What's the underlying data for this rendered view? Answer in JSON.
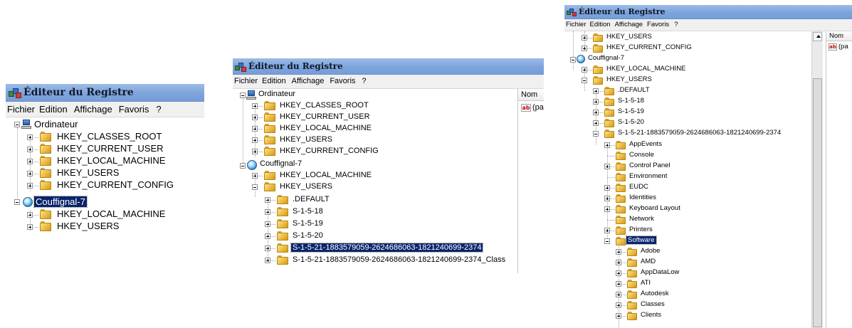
{
  "title": "Éditeur du Registre",
  "menu": [
    "Fichier",
    "Edition",
    "Affichage",
    "Favoris",
    "?"
  ],
  "column_name": "Nom",
  "value_truncated": "(pa",
  "tree": {
    "computer": "Ordinateur",
    "hkcr": "HKEY_CLASSES_ROOT",
    "hkcu": "HKEY_CURRENT_USER",
    "hklm": "HKEY_LOCAL_MACHINE",
    "hku": "HKEY_USERS",
    "hkcc": "HKEY_CURRENT_CONFIG",
    "remote": "Couffignal-7",
    "default": ".DEFAULT",
    "s18": "S-1-5-18",
    "s19": "S-1-5-19",
    "s20": "S-1-5-20",
    "sid": "S-1-5-21-1883579059-2624686063-1821240699-2374",
    "sid_classes_truncated": "S-1-5-21-1883579059-2624686063-1821240699-2374_Class",
    "user_keys": [
      "AppEvents",
      "Console",
      "Control Panel",
      "Environment",
      "EUDC",
      "Identities",
      "Keyboard Layout",
      "Network",
      "Printers",
      "Software"
    ],
    "software_keys": [
      "Adobe",
      "AMD",
      "AppDataLow",
      "ATI",
      "Autodesk",
      "Classes",
      "Clients"
    ]
  }
}
